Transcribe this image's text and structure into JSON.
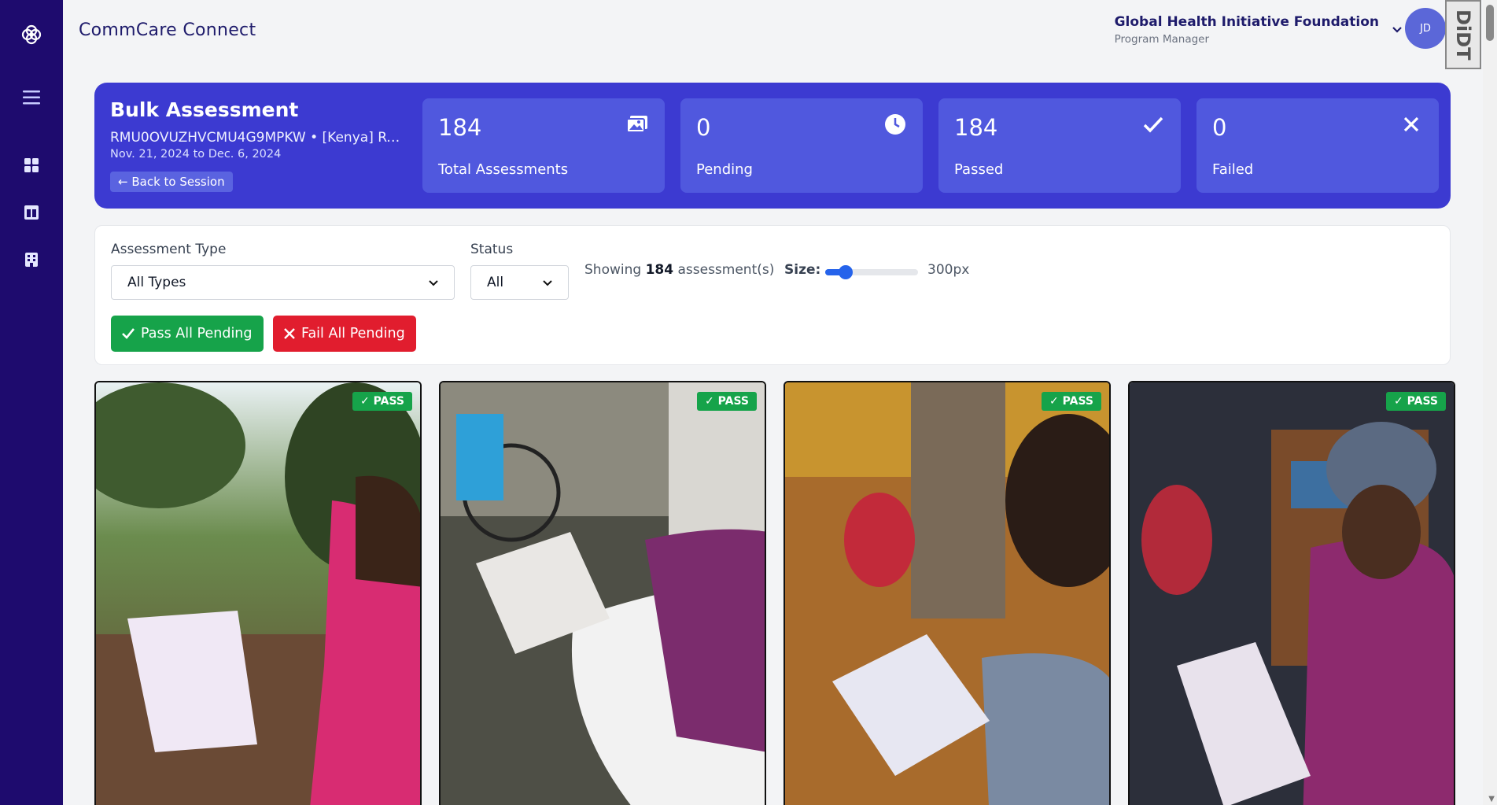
{
  "app": {
    "title": "CommCare Connect"
  },
  "user": {
    "org_name": "Global Health Initiative Foundation",
    "role": "Program Manager",
    "initials": "JD"
  },
  "extension_badge": "DiDT",
  "hero": {
    "title": "Bulk Assessment",
    "session_id": "RMU0OVUZHVCMU4G9MPKW • [Kenya] Re...",
    "dates": "Nov. 21, 2024 to Dec. 6, 2024",
    "back_label": "← Back to Session"
  },
  "stats": [
    {
      "value": "184",
      "label": "Total Assessments",
      "icon": "images-icon"
    },
    {
      "value": "0",
      "label": "Pending",
      "icon": "clock-icon"
    },
    {
      "value": "184",
      "label": "Passed",
      "icon": "check-icon"
    },
    {
      "value": "0",
      "label": "Failed",
      "icon": "x-icon"
    }
  ],
  "filters": {
    "type_label": "Assessment Type",
    "type_value": "All Types",
    "status_label": "Status",
    "status_value": "All",
    "showing_prefix": "Showing",
    "showing_count": "184",
    "showing_suffix": "assessment(s)",
    "size_label": "Size:",
    "size_value": "300px",
    "size_slider_fraction": 0.22,
    "pass_all_label": "Pass All Pending",
    "fail_all_label": "Fail All Pending"
  },
  "cards": [
    {
      "status": "PASS"
    },
    {
      "status": "PASS"
    },
    {
      "status": "PASS"
    },
    {
      "status": "PASS"
    }
  ],
  "colors": {
    "sidebar": "#1e0b6e",
    "hero": "#3c3ad1",
    "pass": "#16a34a",
    "fail": "#e11d2e",
    "accent": "#2563eb"
  }
}
